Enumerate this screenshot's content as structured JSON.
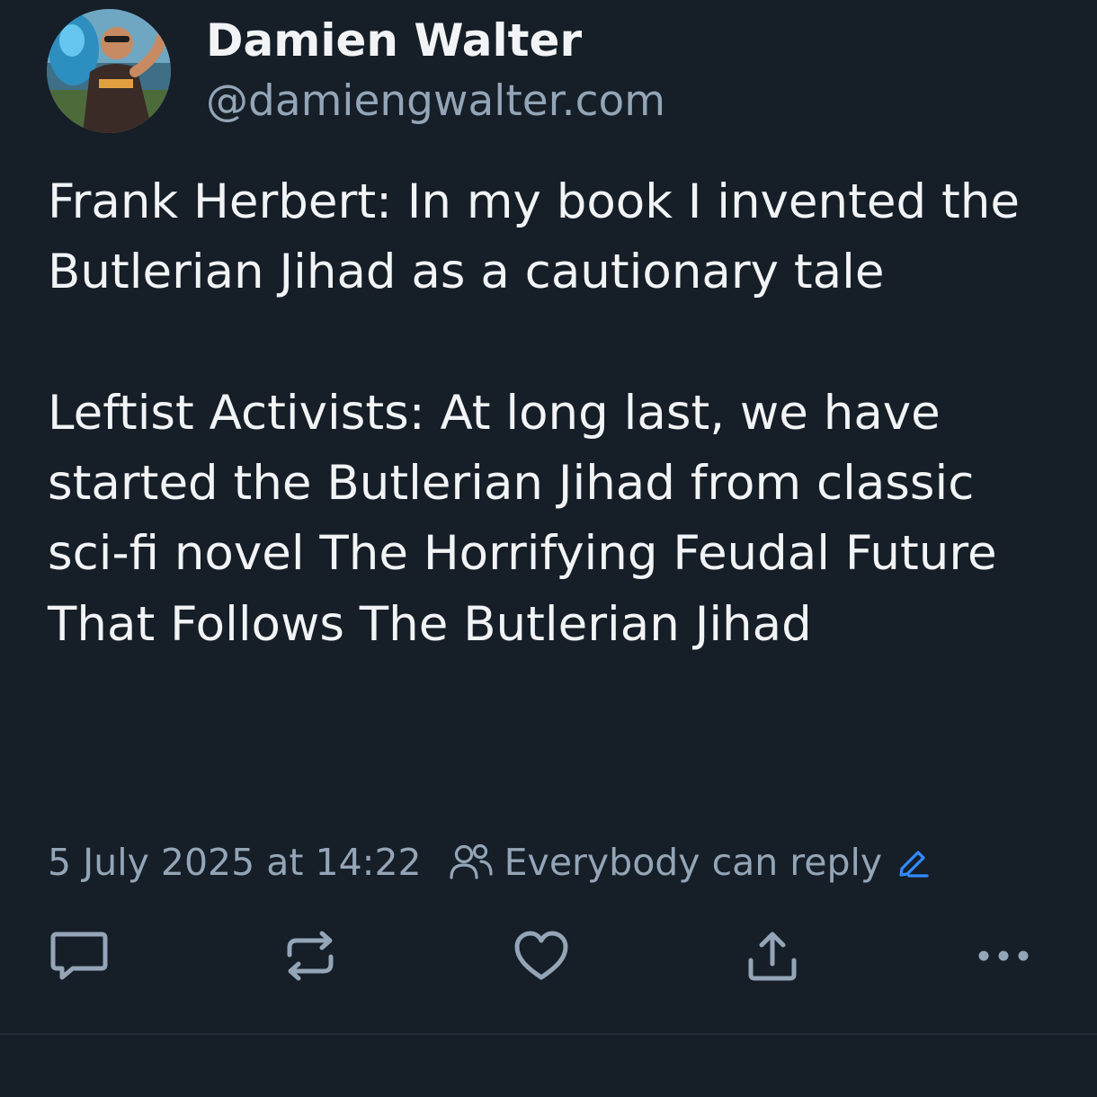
{
  "author": {
    "display_name": "Damien Walter",
    "handle": "@damiengwalter.com"
  },
  "post": {
    "paragraphs": [
      "Frank Herbert: In my book I invented the Butlerian Jihad as a cautionary tale",
      "Leftist Activists: At long last, we have started the Butlerian Jihad from classic sci-fi novel The Horrifying Feudal Future That Follows The Butlerian Jihad"
    ],
    "timestamp": "5 July 2025 at 14:22",
    "reply_setting": "Everybody can reply"
  },
  "icons": {
    "reply_setting": "people-icon",
    "edit": "pencil-icon",
    "reply": "comment-icon",
    "repost": "repost-icon",
    "like": "heart-icon",
    "share": "share-icon",
    "more": "more-icon"
  },
  "colors": {
    "background": "#161e27",
    "text": "#f1f3f5",
    "secondary_text": "#93a5b7",
    "accent": "#2f8cff"
  }
}
